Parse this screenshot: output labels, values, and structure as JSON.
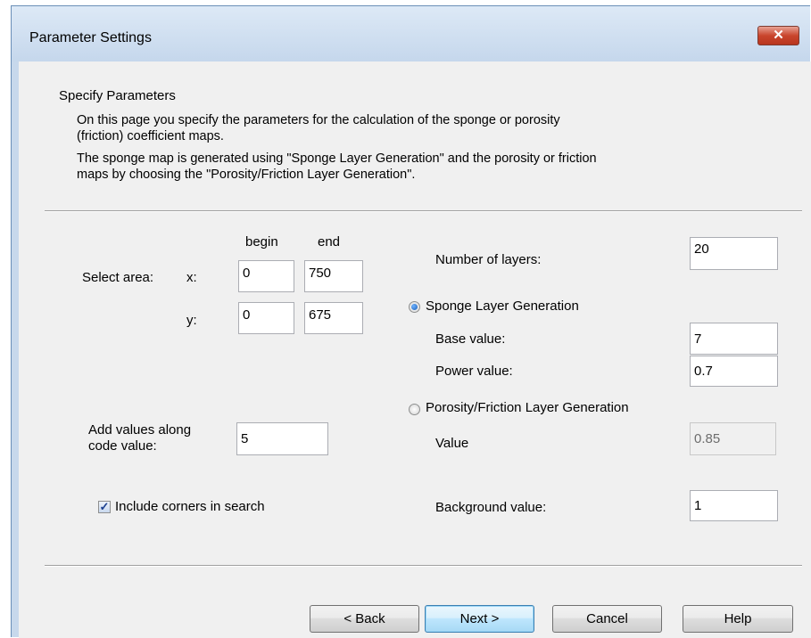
{
  "window": {
    "title": "Parameter Settings",
    "close_label": "✕"
  },
  "header": {
    "title": "Specify Parameters",
    "desc1_line1": "On this page you specify the parameters for the calculation of the sponge or porosity",
    "desc1_line2": "(friction) coefficient maps.",
    "desc2_line1": "The sponge map is generated using \"Sponge Layer Generation\" and the porosity or friction",
    "desc2_line2": "maps by choosing the \"Porosity/Friction Layer Generation\"."
  },
  "area": {
    "begin_label": "begin",
    "end_label": "end",
    "select_label": "Select area:",
    "x_label": "x:",
    "y_label": "y:",
    "x_begin": "0",
    "x_end": "750",
    "y_begin": "0",
    "y_end": "675"
  },
  "add_values": {
    "label_line1": "Add values along",
    "label_line2": "code value:",
    "value": "5"
  },
  "include_corners": {
    "label": "Include corners in search",
    "checked": true
  },
  "layers": {
    "label": "Number of layers:",
    "value": "20"
  },
  "sponge": {
    "label": "Sponge Layer Generation",
    "selected": true,
    "base_label": "Base value:",
    "base_value": "7",
    "power_label": "Power value:",
    "power_value": "0.7"
  },
  "porosity": {
    "label": "Porosity/Friction Layer Generation",
    "selected": false,
    "value_label": "Value",
    "value": "0.85"
  },
  "background": {
    "label": "Background value:",
    "value": "1"
  },
  "buttons": {
    "back": "< Back",
    "next": "Next >",
    "cancel": "Cancel",
    "help": "Help"
  }
}
